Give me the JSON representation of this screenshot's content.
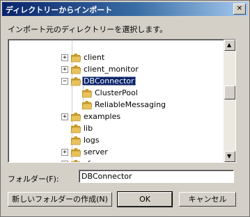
{
  "window": {
    "title": "ディレクトリーからインポート",
    "close_glyph": "✕"
  },
  "instruction": "インポート元のディレクトリーを選択します。",
  "tree": {
    "items": [
      {
        "label": "client",
        "expander": "+",
        "selected": false
      },
      {
        "label": "client_monitor",
        "expander": "+",
        "selected": false
      },
      {
        "label": "DBConnector",
        "expander": "−",
        "selected": true
      },
      {
        "label": "ClusterPool",
        "expander": "",
        "selected": false
      },
      {
        "label": "ReliableMessaging",
        "expander": "",
        "selected": false
      },
      {
        "label": "examples",
        "expander": "+",
        "selected": false
      },
      {
        "label": "lib",
        "expander": "",
        "selected": false
      },
      {
        "label": "logs",
        "expander": "",
        "selected": false
      },
      {
        "label": "server",
        "expander": "+",
        "selected": false
      },
      {
        "label": "sfo",
        "expander": "+",
        "selected": false
      }
    ],
    "scrollbar": {
      "up_glyph": "▲",
      "down_glyph": "▼"
    }
  },
  "folder": {
    "label": "フォルダー(F):",
    "value": "DBConnector"
  },
  "buttons": {
    "new_folder": "新しいフォルダーの作成(N)",
    "ok": "OK",
    "cancel": "キャンセル"
  },
  "colors": {
    "selection": "#0a246a",
    "folder": "#e8c25a",
    "dialog_bg": "#d4d0c8"
  }
}
